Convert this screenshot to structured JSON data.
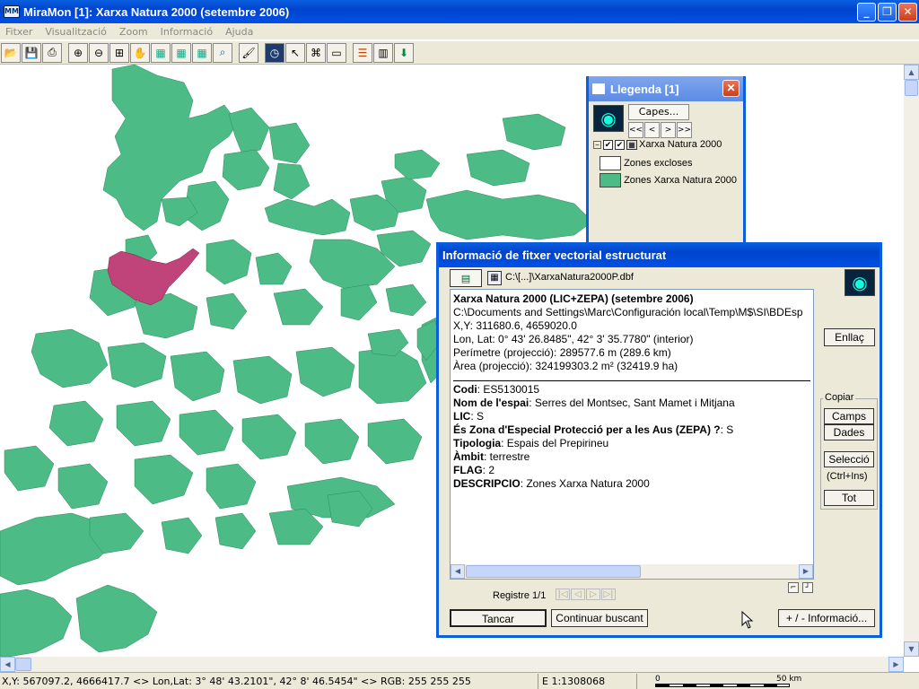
{
  "window": {
    "title": "MiraMon [1]:  Xarxa Natura 2000 (setembre 2006)",
    "minimize": "_",
    "maximize": "❐",
    "close": "✕"
  },
  "menu": [
    "Fitxer",
    "Visualització",
    "Zoom",
    "Informació",
    "Ajuda"
  ],
  "toolbar": [
    "open-icon",
    "save-icon",
    "print-icon",
    "zoom-in-icon",
    "zoom-out-icon",
    "zoom-window-icon",
    "pan-icon",
    "map-view-icon",
    "map-view2-icon",
    "map-view3-icon",
    "map-search-icon",
    "brush-icon",
    "clock-icon",
    "pointer-icon",
    "binoculars-icon",
    "measure-icon",
    "layers-icon",
    "grid-icon",
    "export-icon"
  ],
  "colors": {
    "natura": "#4cbb85",
    "selected": "#c0437a",
    "excluded": "#ffffff"
  },
  "legend": {
    "title": "Llegenda [1]",
    "capes_button": "Capes...",
    "nav": [
      "<<",
      "<",
      ">",
      ">>"
    ],
    "layer_name": "Xarxa Natura 2000",
    "items": [
      {
        "label": "Zones excloses",
        "color": "#ffffff"
      },
      {
        "label": "Zones Xarxa Natura 2000",
        "color": "#4cbb85"
      }
    ]
  },
  "info": {
    "title": "Informació de fitxer vectorial estructurat",
    "path": "C:\\[...]\\XarxaNatura2000P.dbf",
    "lines": [
      {
        "bold": "Xarxa Natura 2000 (LIC+ZEPA) (setembre 2006)",
        "text": ""
      },
      {
        "bold": "",
        "text": "C:\\Documents and Settings\\Marc\\Configuración local\\Temp\\M$\\SI\\BDEsp"
      },
      {
        "bold": "",
        "text": "X,Y: 311680.6, 4659020.0"
      },
      {
        "bold": "",
        "text": "Lon, Lat: 0° 43' 26.8485\", 42° 3' 35.7780\" (interior)"
      },
      {
        "bold": "",
        "text": "Perímetre (projecció): 289577.6 m (289.6 km)"
      },
      {
        "bold": "",
        "text": "Àrea (projecció): 324199303.2 m² (32419.9 ha)"
      }
    ],
    "fields": [
      {
        "name": "Codi",
        "value": ": ES5130015"
      },
      {
        "name": "Nom de l'espai",
        "value": ": Serres del Montsec, Sant Mamet i Mitjana"
      },
      {
        "name": "LIC",
        "value": ": S"
      },
      {
        "name": "És Zona d'Especial Protecció per a les Aus (ZEPA) ?",
        "value": ": S"
      },
      {
        "name": "Tipologia",
        "value": ": Espais del Prepirineu"
      },
      {
        "name": "Àmbit",
        "value": ": terrestre"
      },
      {
        "name": "FLAG",
        "value": ": 2"
      },
      {
        "name": "DESCRIPCIO",
        "value": ": Zones Xarxa Natura 2000"
      }
    ],
    "buttons": {
      "enllac": "Enllaç",
      "copiar": "Copiar",
      "camps": "Camps",
      "dades": "Dades",
      "seleccio": "Selecció",
      "ctrlins": "(Ctrl+Ins)",
      "tot": "Tot",
      "tancar": "Tancar",
      "continuar": "Continuar buscant",
      "mes_info": "+ / - Informació..."
    },
    "registre": "Registre 1/1"
  },
  "status": {
    "coords": "X,Y: 567097.2, 4666417.7 <> Lon,Lat: 3° 48' 43.2101\", 42° 8' 46.5454\" <> RGB: 255 255 255",
    "scale": "E 1:1308068",
    "scalebar_start": "0",
    "scalebar_end": "50 km"
  }
}
